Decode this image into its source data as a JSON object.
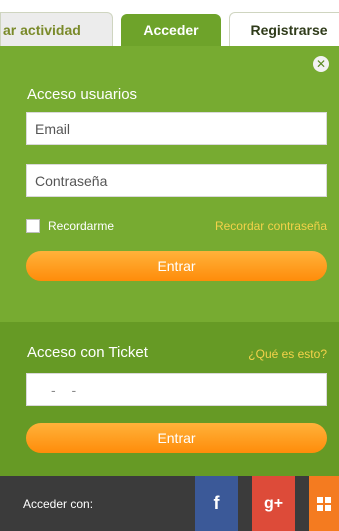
{
  "tabs": {
    "left_label": "ar actividad",
    "active_label": "Acceder",
    "right_label": "Registrarse"
  },
  "login": {
    "title": "Acceso usuarios",
    "email_placeholder": "Email",
    "password_placeholder": "Contraseña",
    "remember_label": "Recordarme",
    "forgot_link": "Recordar contraseña",
    "submit_label": "Entrar"
  },
  "ticket": {
    "title": "Acceso con Ticket",
    "whatis_link": "¿Qué es esto?",
    "ticket_value": "- -",
    "submit_label": "Entrar"
  },
  "social": {
    "label": "Acceder con:",
    "facebook": "f",
    "googleplus": "g+"
  },
  "colors": {
    "panel_green": "#77ab31",
    "button_orange": "#ff9a1a",
    "link_yellow": "#f3d24a",
    "facebook_blue": "#3b5998",
    "googleplus_red": "#dd4b39",
    "microsoft_orange": "#f47b20"
  }
}
